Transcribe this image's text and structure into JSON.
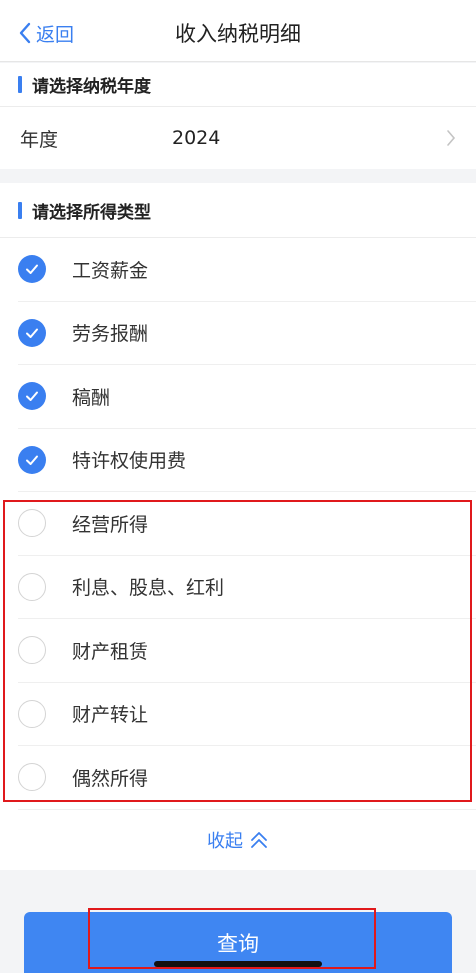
{
  "nav": {
    "back_label": "返回",
    "title": "收入纳税明细"
  },
  "year_section": {
    "heading": "请选择纳税年度",
    "label": "年度",
    "value": "2024"
  },
  "type_section": {
    "heading": "请选择所得类型",
    "items": [
      {
        "label": "工资薪金",
        "checked": true
      },
      {
        "label": "劳务报酬",
        "checked": true
      },
      {
        "label": "稿酬",
        "checked": true
      },
      {
        "label": "特许权使用费",
        "checked": true
      },
      {
        "label": "经营所得",
        "checked": false
      },
      {
        "label": "利息、股息、红利",
        "checked": false
      },
      {
        "label": "财产租赁",
        "checked": false
      },
      {
        "label": "财产转让",
        "checked": false
      },
      {
        "label": "偶然所得",
        "checked": false
      }
    ]
  },
  "collapse_label": "收起",
  "query_label": "查询",
  "colors": {
    "accent": "#3a7ff0",
    "highlight": "#e0191c",
    "background": "#f3f4f6"
  }
}
